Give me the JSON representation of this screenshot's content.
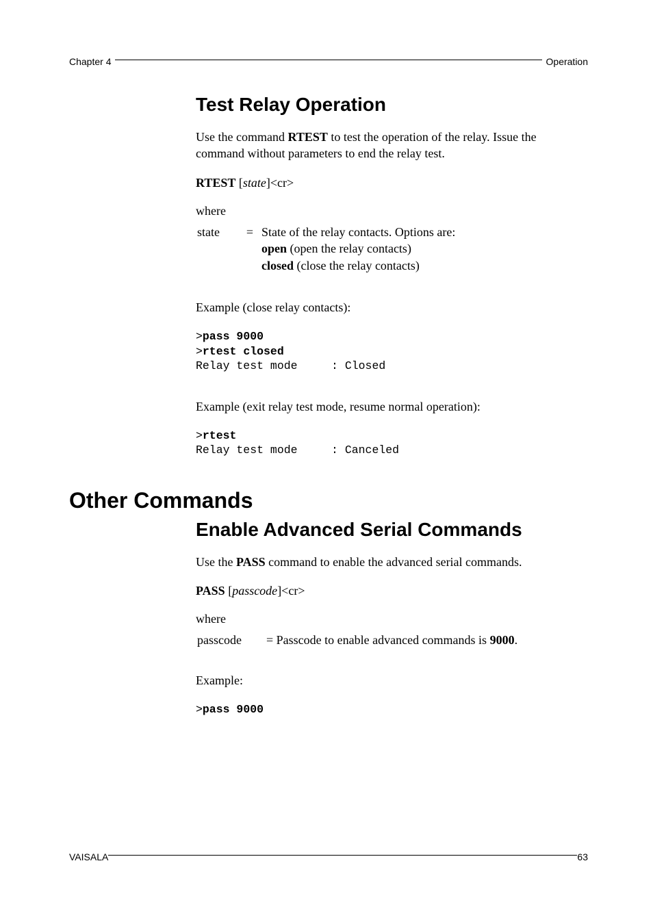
{
  "header": {
    "left": "Chapter 4",
    "right": "Operation"
  },
  "section1": {
    "title": "Test Relay Operation",
    "para1_a": "Use the command ",
    "para1_b": "RTEST",
    "para1_c": " to test the operation of the relay. Issue the command without parameters to end the relay test.",
    "syntax_cmd": "RTEST",
    "syntax_open": " [",
    "syntax_arg": "state",
    "syntax_close": "]<cr>",
    "where": "where",
    "def_term": "state",
    "def_eq": "=",
    "def_line1": "State of the relay contacts. Options are:",
    "def_line2_a": "open",
    "def_line2_b": " (open the relay contacts)",
    "def_line3_a": "closed",
    "def_line3_b": " (close the relay contacts)",
    "ex1_label": "Example (close relay contacts):",
    "ex1_gt1": ">",
    "ex1_cmd1": "pass 9000",
    "ex1_gt2": ">",
    "ex1_cmd2": "rtest closed",
    "ex1_out": "Relay test mode     : Closed",
    "ex2_label": "Example (exit relay test mode, resume normal operation):",
    "ex2_gt1": ">",
    "ex2_cmd1": "rtest",
    "ex2_out": "Relay test mode     : Canceled"
  },
  "section2": {
    "title": "Other Commands",
    "sub_title": "Enable Advanced Serial Commands",
    "para1_a": "Use the ",
    "para1_b": "PASS",
    "para1_c": " command to enable the advanced serial commands.",
    "syntax_cmd": "PASS",
    "syntax_open": " [",
    "syntax_arg": "passcode",
    "syntax_close": "]<cr>",
    "where": " where",
    "def_term": " passcode",
    "def_body_a": "= Passcode to enable advanced commands is ",
    "def_body_b": "9000",
    "def_body_c": ".",
    "ex_label": "Example:",
    "ex_gt": ">",
    "ex_cmd": "pass 9000"
  },
  "footer": {
    "left": "VAISALA",
    "right": "63"
  }
}
